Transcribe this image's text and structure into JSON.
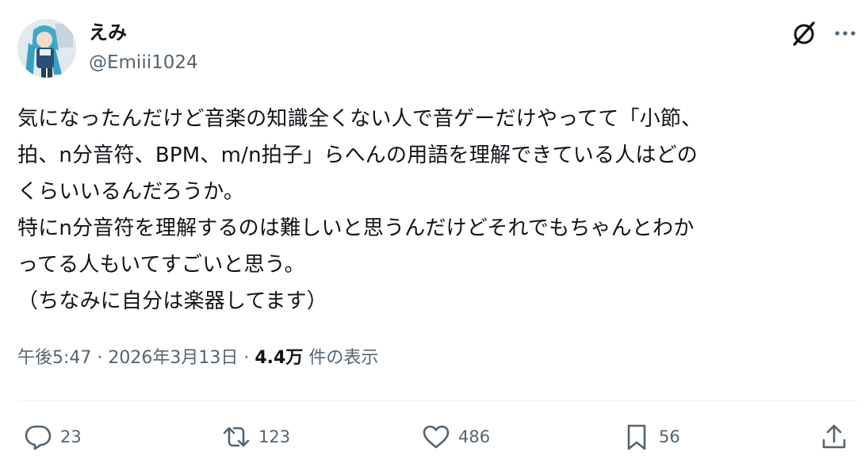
{
  "author": {
    "display_name": "えみ",
    "handle": "@Emiii1024",
    "avatar_icon": "avatar-anime-character"
  },
  "header_icons": [
    "grok-icon",
    "more-icon"
  ],
  "tweet": {
    "lines": [
      "気になったんだけど音楽の知識全くない人で音ゲーだけやってて「小節、",
      "拍、n分音符、BPM、m/n拍子」らへんの用語を理解できている人はどの",
      "くらいいるんだろうか。",
      "特にn分音符を理解するのは難しいと思うんだけどそれでもちゃんとわか",
      "ってる人もいてすごいと思う。",
      "（ちなみに自分は楽器してます）"
    ]
  },
  "meta": {
    "time": "午後5:47",
    "separator1": " · ",
    "date": "2026年3月13日",
    "separator2": " · ",
    "views_count": "4.4万",
    "views_label": " 件の表示"
  },
  "actions": {
    "reply": {
      "icon": "reply-icon",
      "count": "23"
    },
    "retweet": {
      "icon": "retweet-icon",
      "count": "123"
    },
    "like": {
      "icon": "heart-icon",
      "count": "486"
    },
    "bookmark": {
      "icon": "bookmark-icon",
      "count": "56"
    },
    "share": {
      "icon": "share-icon"
    }
  },
  "colors": {
    "text": "#0f1419",
    "secondary": "#536471",
    "divider": "#eff3f4",
    "background": "#ffffff"
  }
}
